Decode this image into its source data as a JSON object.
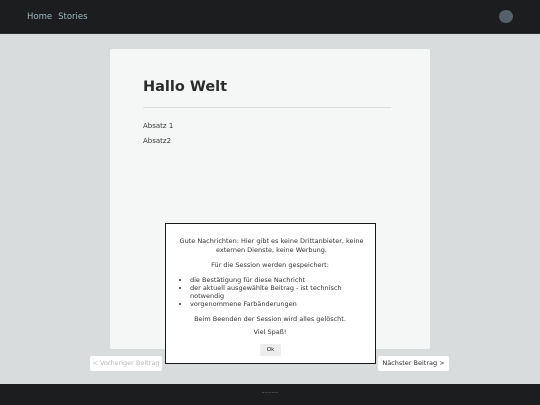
{
  "nav": {
    "home": "Home",
    "stories": "Stories"
  },
  "article": {
    "title": "Hallo Welt",
    "paragraphs": [
      "Absatz 1",
      "Absatz2"
    ]
  },
  "pager": {
    "prev": "< Vorheriger Beitrag",
    "next": "Nächster Beitrag >"
  },
  "footer": {
    "text": "~~~~~"
  },
  "modal": {
    "intro": "Gute Nachrichten: Hier gibt es keine Drittanbieter, keine externen Dienste, keine Werbung.",
    "session_heading": "Für die Session werden gespeichert:",
    "items": [
      "die Bestätigung für diese Nachricht",
      "der aktuell ausgewählte Beitrag - ist technisch notwendig",
      "vorgenommene Farbänderungen"
    ],
    "end": "Beim Beenden der Session wird alles gelöscht.",
    "fun": "Viel Spaß!",
    "ok": "Ok"
  },
  "colors": {
    "topbar": "#1b1d1e",
    "background": "#d9dcdc",
    "card": "#f5f6f6",
    "nav_link": "#9fb8c4"
  }
}
